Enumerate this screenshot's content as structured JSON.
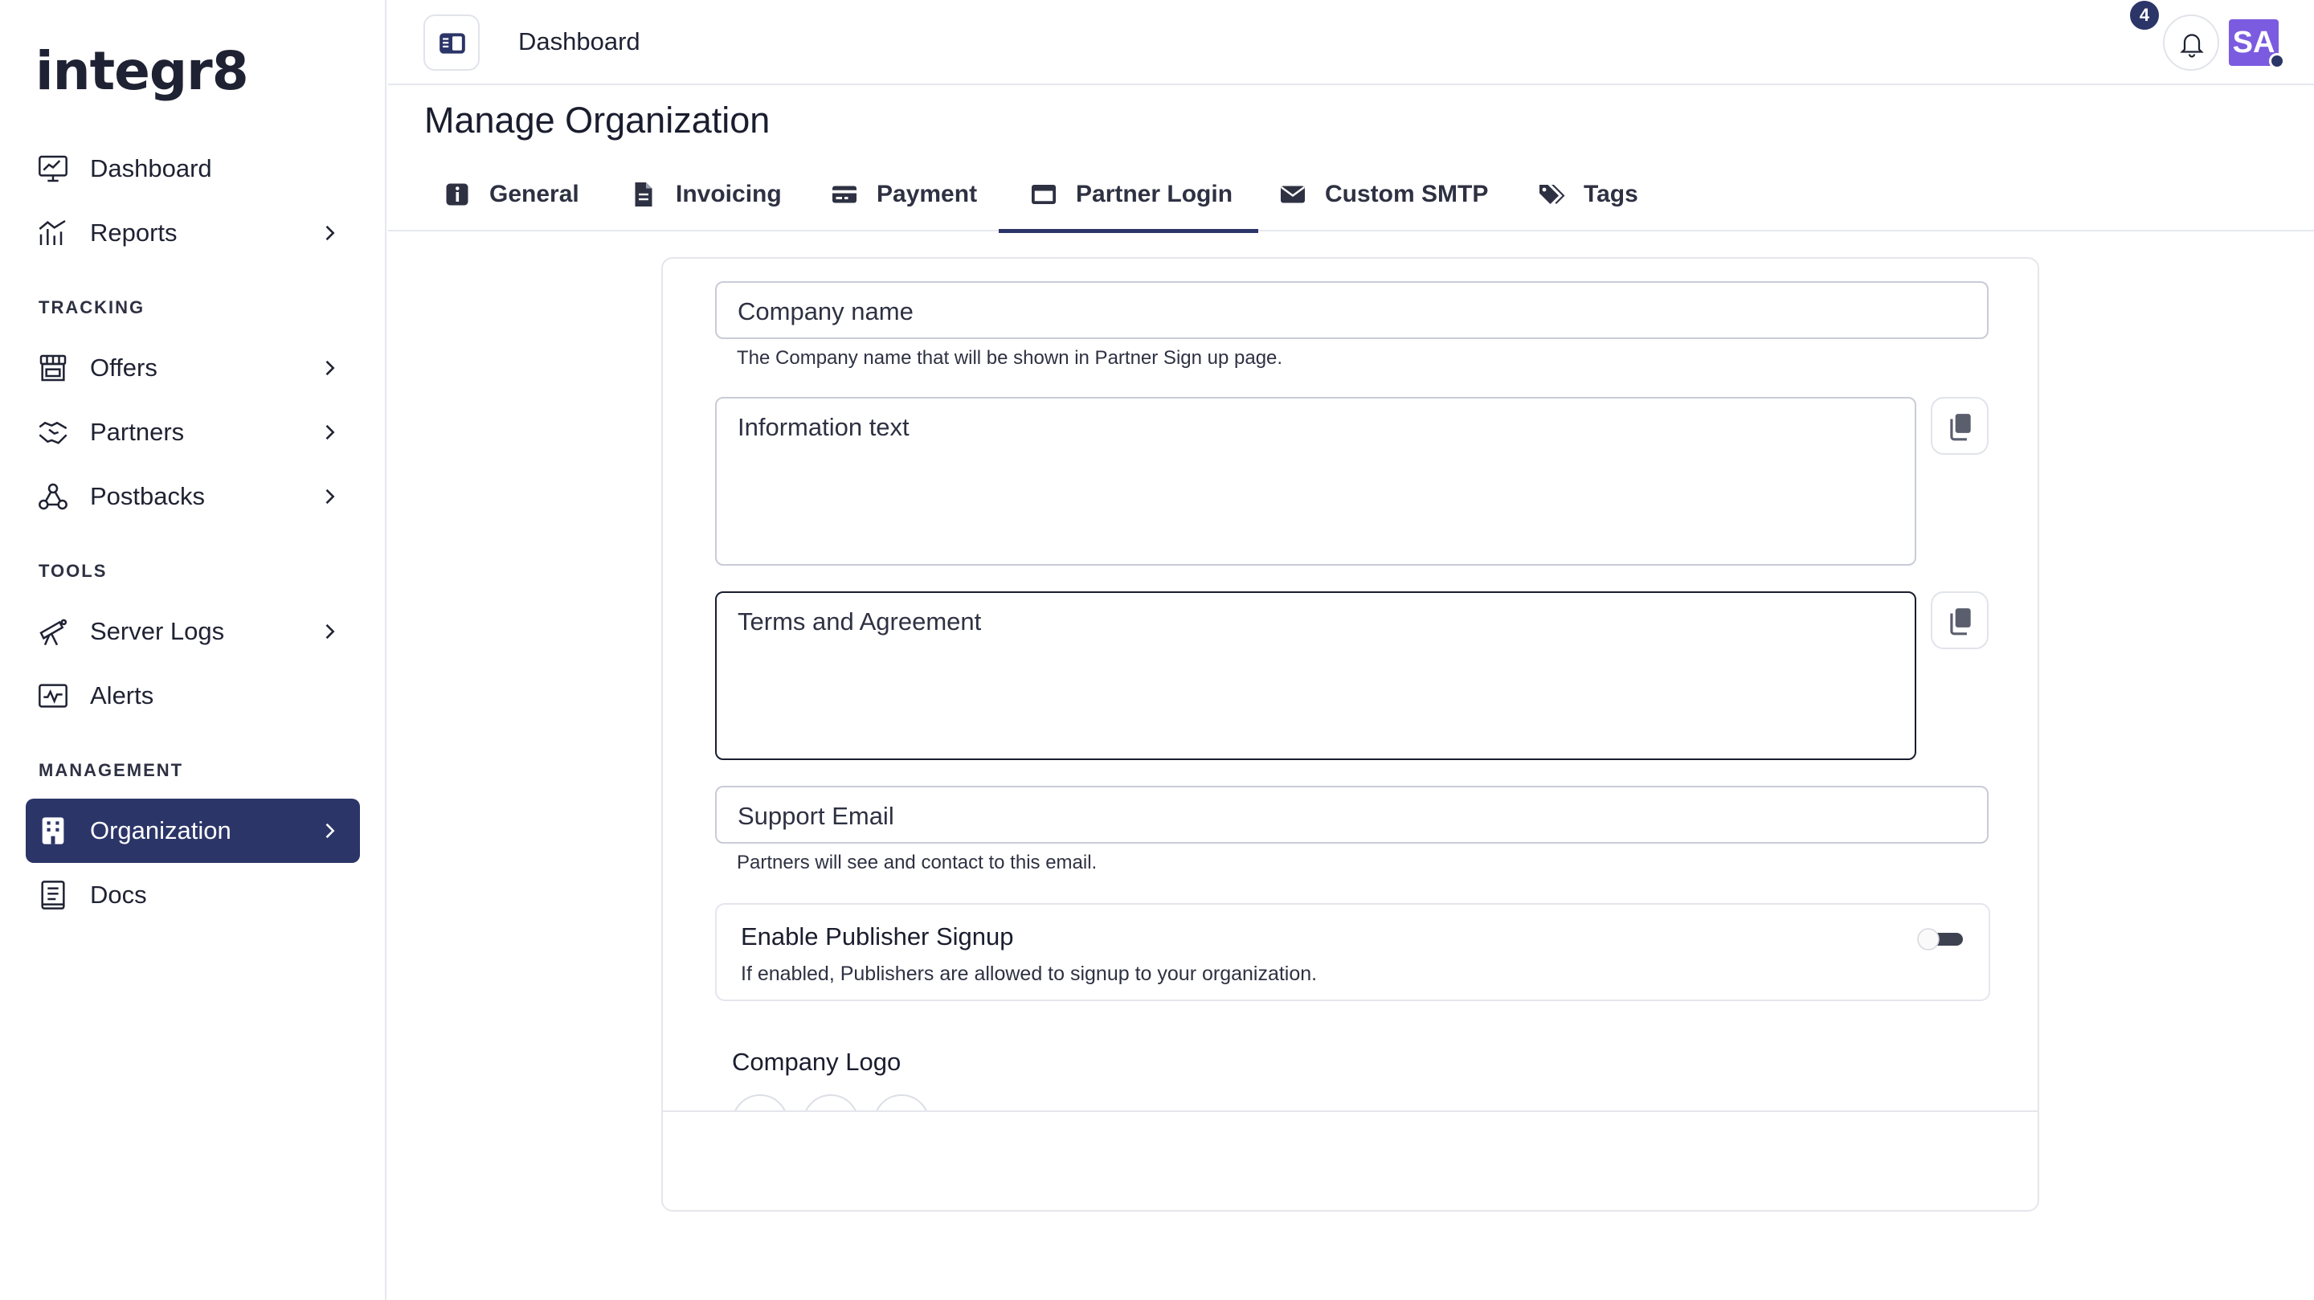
{
  "app": {
    "logo_text": "integr8"
  },
  "sidebar": {
    "items": [
      {
        "label": "Dashboard",
        "icon": "chart-line-icon"
      },
      {
        "label": "Reports",
        "icon": "bar-chart-icon"
      }
    ],
    "tracking_label": "TRACKING",
    "tracking_items": [
      {
        "label": "Offers",
        "icon": "store-icon"
      },
      {
        "label": "Partners",
        "icon": "handshake-icon"
      },
      {
        "label": "Postbacks",
        "icon": "webhook-icon"
      }
    ],
    "tools_label": "TOOLS",
    "tools_items": [
      {
        "label": "Server Logs",
        "icon": "telescope-icon"
      },
      {
        "label": "Alerts",
        "icon": "pulse-icon"
      }
    ],
    "management_label": "MANAGEMENT",
    "management_items": [
      {
        "label": "Organization",
        "icon": "building-icon"
      },
      {
        "label": "Docs",
        "icon": "book-icon"
      }
    ]
  },
  "topbar": {
    "breadcrumb": "Dashboard",
    "notification_count": "4",
    "avatar_initials": "SA"
  },
  "page": {
    "title": "Manage Organization",
    "tabs": [
      {
        "label": "General"
      },
      {
        "label": "Invoicing"
      },
      {
        "label": "Payment"
      },
      {
        "label": "Partner Login"
      },
      {
        "label": "Custom SMTP"
      },
      {
        "label": "Tags"
      }
    ],
    "active_tab": "Partner Login"
  },
  "form": {
    "company_name": {
      "placeholder": "Company name",
      "value": "",
      "helper": "The Company name that will be shown in Partner Sign up page."
    },
    "information_text": {
      "placeholder": "Information text",
      "value": ""
    },
    "terms": {
      "placeholder": "Terms and Agreement",
      "value": ""
    },
    "support_email": {
      "placeholder": "Support Email",
      "value": "",
      "helper": "Partners will see and contact to this email."
    },
    "publisher_signup": {
      "title": "Enable Publisher Signup",
      "description": "If enabled, Publishers are allowed to signup to your organization.",
      "enabled": false
    },
    "company_logo_label": "Company Logo"
  },
  "colors": {
    "primary": "#2c3568",
    "avatar": "#7b5be0",
    "border": "#c9ccd6"
  }
}
